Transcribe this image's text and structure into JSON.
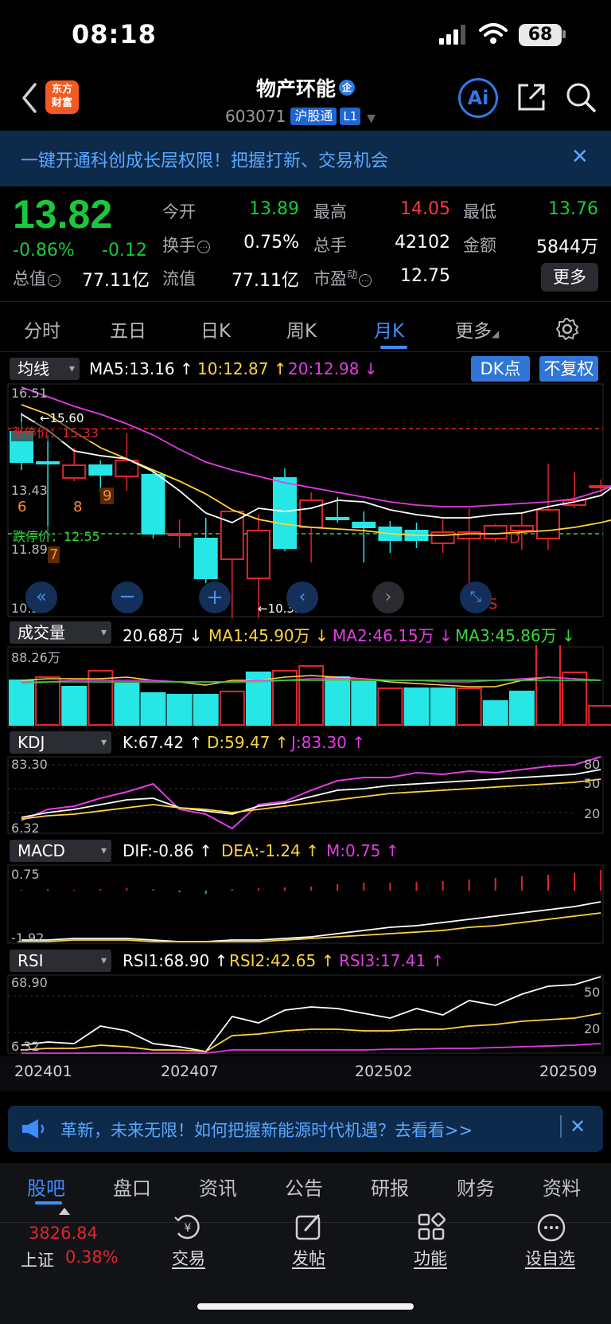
{
  "status_bar": {
    "time": "08:18",
    "battery": "68"
  },
  "header": {
    "logo_line1": "东方",
    "logo_line2": "财富",
    "stock_name": "物产环能",
    "ent_badge": "企",
    "code": "603071",
    "hgt": "沪股通",
    "level": "L1",
    "ai_label": "Ai"
  },
  "banner": {
    "text": "一键开通科创成长层权限！把握打新、交易机会",
    "close": "✕"
  },
  "quote": {
    "price": "13.82",
    "change_pct": "-0.86%",
    "change_amt": "-0.12",
    "open_label": "今开",
    "open": "13.89",
    "high_label": "最高",
    "high": "14.05",
    "low_label": "最低",
    "low": "13.76",
    "turnover_label": "换手",
    "turnover": "0.75%",
    "volume_label": "总手",
    "volume": "42102",
    "amount_label": "金额",
    "amount": "5844万",
    "mktcap_label": "总值",
    "mktcap": "77.11亿",
    "float_label": "流值",
    "float": "77.11亿",
    "pe_label": "市盈",
    "pe_sup": "动",
    "pe": "12.75",
    "more_button": "更多"
  },
  "tabs": [
    "分时",
    "五日",
    "日K",
    "周K",
    "月K",
    "更多"
  ],
  "active_tab": "月K",
  "main_indicator": {
    "selector": "均线",
    "ma5": "MA5:13.16 ↑",
    "ma10": "10:12.87 ↑",
    "ma20": "20:12.98 ↓",
    "dk_button": "DK点",
    "fq_button": "不复权",
    "y_top": "16.51",
    "y_mid1": "13.43",
    "y_mid2": "11.89",
    "y_bottom": "10.35",
    "limit_up": "涨停价：15.33",
    "limit_down": "跌停价：12.55",
    "high_mark": "←15.60",
    "low_mark": "←10.35",
    "tags": [
      "6",
      "7",
      "8",
      "9",
      "D",
      "S",
      "S"
    ],
    "colors": {
      "up": "#e0262b",
      "down": "#26e6e6",
      "ma5": "#ffffff",
      "ma10": "#ffd43b",
      "ma20": "#e53be5"
    }
  },
  "volume_indicator": {
    "selector": "成交量",
    "value": "20.68万 ↓",
    "ma1": "MA1:45.90万 ↓",
    "ma2": "MA2:46.15万 ↓",
    "ma3": "MA3:45.86万 ↓",
    "y_top": "88.26万"
  },
  "kdj": {
    "selector": "KDJ",
    "k": "K:67.42 ↑",
    "d": "D:59.47 ↑",
    "j": "J:83.30 ↑",
    "y_top": "83.30",
    "y_bottom": "6.32",
    "r80": "80",
    "r50": "50",
    "r20": "20"
  },
  "macd": {
    "selector": "MACD",
    "dif": "DIF:-0.86 ↑",
    "dea": "DEA:-1.24 ↑",
    "m": "M:0.75 ↑",
    "y_top": "0.75",
    "y_bottom": "-1.92"
  },
  "rsi": {
    "selector": "RSI",
    "rsi1": "RSI1:68.90 ↑",
    "rsi2": "RSI2:42.65 ↑",
    "rsi3": "RSI3:17.41 ↑",
    "y_top": "68.90",
    "y_bottom": "6.32",
    "r50": "50",
    "r20": "20"
  },
  "x_axis": [
    "202401",
    "202407",
    "202502",
    "202509"
  ],
  "promo": {
    "text": "革新，未来无限！如何把握新能源时代机遇？去看看>>",
    "close": "✕"
  },
  "bottom_tabs": [
    "股吧",
    "盘口",
    "资讯",
    "公告",
    "研报",
    "财务",
    "资料"
  ],
  "active_bottom_tab": "股吧",
  "index": {
    "value": "3826.84",
    "name": "上证",
    "pct": "0.38%"
  },
  "nav": [
    "交易",
    "发帖",
    "功能",
    "设自选"
  ]
}
